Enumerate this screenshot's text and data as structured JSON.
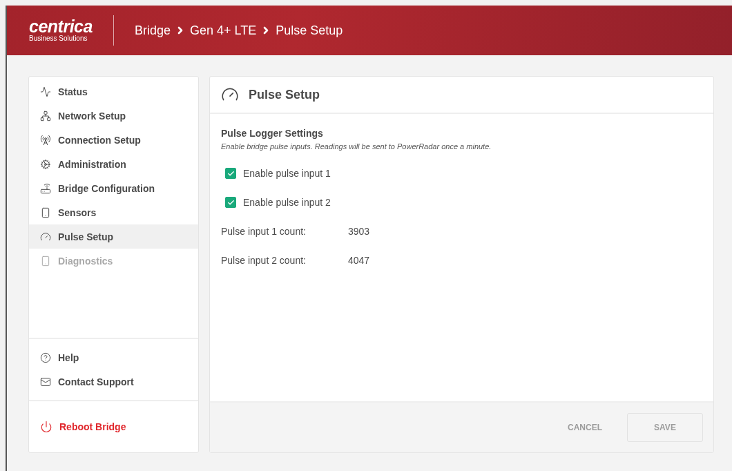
{
  "header": {
    "logo": "centrica",
    "logo_subtitle": "Business Solutions",
    "breadcrumb": [
      "Bridge",
      "Gen 4+ LTE",
      "Pulse Setup"
    ]
  },
  "sidebar": {
    "items": [
      {
        "label": "Status",
        "selected": false,
        "disabled": false
      },
      {
        "label": "Network Setup",
        "selected": false,
        "disabled": false
      },
      {
        "label": "Connection Setup",
        "selected": false,
        "disabled": false
      },
      {
        "label": "Administration",
        "selected": false,
        "disabled": false
      },
      {
        "label": "Bridge Configuration",
        "selected": false,
        "disabled": false
      },
      {
        "label": "Sensors",
        "selected": false,
        "disabled": false
      },
      {
        "label": "Pulse Setup",
        "selected": true,
        "disabled": false
      },
      {
        "label": "Diagnostics",
        "selected": false,
        "disabled": true
      }
    ],
    "support_items": [
      {
        "label": "Help"
      },
      {
        "label": "Contact Support"
      }
    ],
    "reboot": {
      "label": "Reboot Bridge"
    }
  },
  "panel": {
    "title": "Pulse Setup",
    "section_title": "Pulse Logger Settings",
    "description": "Enable bridge pulse inputs. Readings will be sent to PowerRadar once a minute.",
    "checkboxes": [
      {
        "label": "Enable pulse input 1",
        "checked": true
      },
      {
        "label": "Enable pulse input 2",
        "checked": true
      }
    ],
    "counts": [
      {
        "label": "Pulse input 1 count:",
        "value": "3903"
      },
      {
        "label": "Pulse input 2 count:",
        "value": "4047"
      }
    ],
    "buttons": [
      {
        "label": "CANCEL",
        "kind": "text",
        "disabled": true
      },
      {
        "label": "SAVE",
        "kind": "outlined",
        "disabled": true
      }
    ]
  }
}
